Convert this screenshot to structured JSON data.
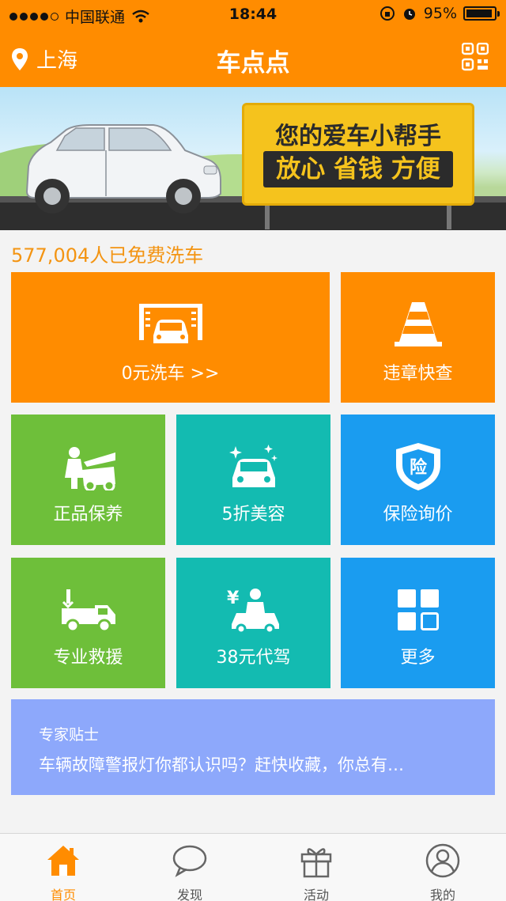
{
  "status_bar": {
    "carrier": "中国联通",
    "time": "18:44",
    "battery": "95%"
  },
  "header": {
    "location": "上海",
    "title": "车点点"
  },
  "banner": {
    "line1": "您的爱车小帮手",
    "line2": "放心 省钱 方便"
  },
  "counter": "577,004人已免费洗车",
  "tiles": [
    {
      "label": "0元洗车 >>",
      "icon": "car-wash-icon"
    },
    {
      "label": "违章快查",
      "icon": "traffic-cone-icon"
    },
    {
      "label": "正品保养",
      "icon": "mechanic-icon"
    },
    {
      "label": "5折美容",
      "icon": "sparkle-car-icon"
    },
    {
      "label": "保险询价",
      "icon": "insurance-shield-icon"
    },
    {
      "label": "专业救援",
      "icon": "tow-truck-icon"
    },
    {
      "label": "38元代驾",
      "icon": "driver-icon"
    },
    {
      "label": "更多",
      "icon": "grid-icon"
    }
  ],
  "insurance_badge": "险",
  "tip": {
    "heading": "专家贴士",
    "body": "车辆故障警报灯你都认识吗？赶快收藏，你总有…"
  },
  "tabs": [
    {
      "label": "首页",
      "icon": "home-icon",
      "active": true
    },
    {
      "label": "发现",
      "icon": "chat-bubble-icon"
    },
    {
      "label": "活动",
      "icon": "gift-icon"
    },
    {
      "label": "我的",
      "icon": "user-icon"
    }
  ],
  "colors": {
    "accent": "#ff8c00",
    "green": "#6ebf3a",
    "teal": "#13bbb1",
    "blue": "#1a9cf0",
    "tip_bg": "#8da8fb"
  }
}
